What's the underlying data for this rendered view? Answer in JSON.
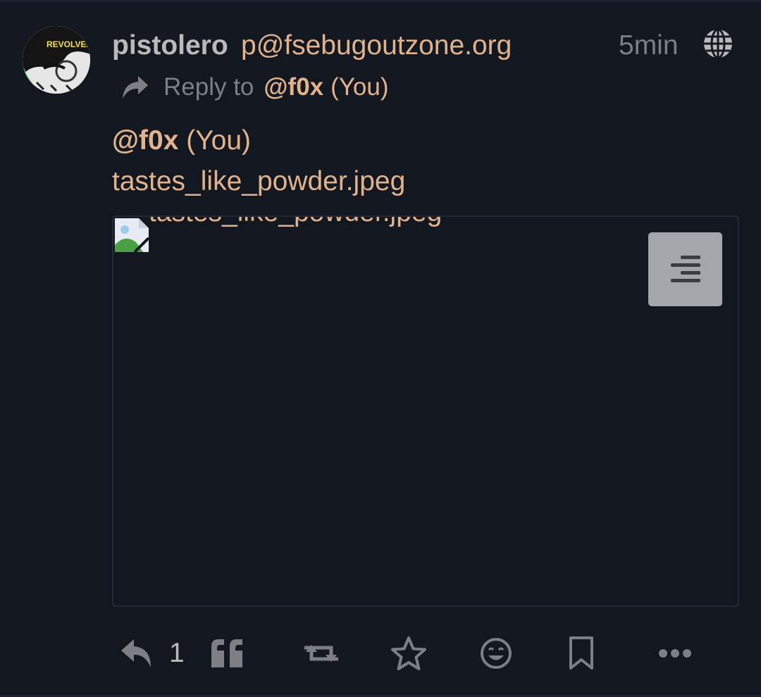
{
  "account": {
    "display_name": "pistolero",
    "handle": "p@fsebugoutzone.org",
    "avatar_text": "REVOLVER"
  },
  "status": {
    "timestamp": "5min",
    "visibility_icon": "globe-icon",
    "reply_label": "Reply to",
    "reply_target": "@f0x",
    "reply_target_suffix": "(You)",
    "content_mention": "@f0x",
    "content_mention_suffix": "(You)",
    "content_text": "tastes_like_powder.jpeg"
  },
  "attachment": {
    "alt": "tastes_like_powder.jpeg",
    "description_icon": "text-align-icon"
  },
  "actions": {
    "reply_count": "1",
    "icons": [
      "reply-icon",
      "quote-icon",
      "boost-icon",
      "favourite-icon",
      "emoji-react-icon",
      "bookmark-icon",
      "more-icon"
    ]
  },
  "colors": {
    "background": "#121720",
    "accent": "#e0b28d",
    "text": "#b9b9ba",
    "muted": "#7d7f85"
  }
}
